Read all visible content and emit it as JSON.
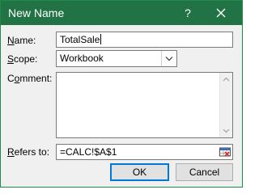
{
  "dialog": {
    "title": "New Name",
    "help_glyph": "?",
    "close_icon": "close-icon",
    "titlebar_color": "#217346"
  },
  "form": {
    "name_label_key": "N",
    "name_label_rest": "ame:",
    "name_value": "TotalSale",
    "scope_label_key": "S",
    "scope_label_rest": "cope:",
    "scope_value": "Workbook",
    "comment_label_pre": "C",
    "comment_label_key": "o",
    "comment_label_rest": "mment:",
    "refers_label_key": "R",
    "refers_label_rest": "efers to:",
    "refers_value": "=CALC!$A$1"
  },
  "buttons": {
    "ok_label": "OK",
    "cancel_label": "Cancel"
  }
}
